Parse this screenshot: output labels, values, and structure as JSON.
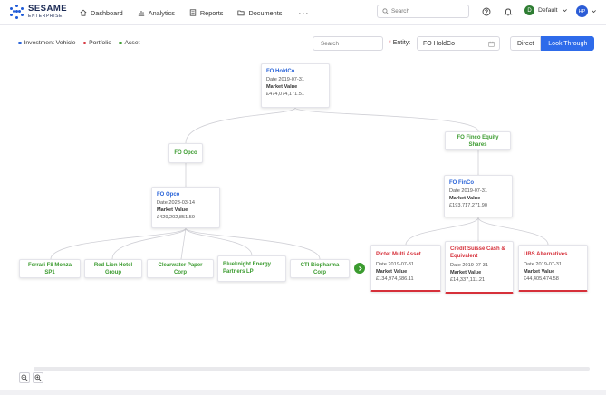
{
  "brand": {
    "name": "SESAME",
    "sub": "ENTERPRISE",
    "color": "#1f5bd8"
  },
  "nav": [
    {
      "label": "Dashboard",
      "icon": "home-icon"
    },
    {
      "label": "Analytics",
      "icon": "bar-chart-icon"
    },
    {
      "label": "Reports",
      "icon": "report-icon"
    },
    {
      "label": "Documents",
      "icon": "folder-icon"
    }
  ],
  "nav_more": "···",
  "search": {
    "placeholder": "Search"
  },
  "profile": {
    "initial": "D",
    "label": "Default"
  },
  "user": {
    "initials": "HP"
  },
  "legend": [
    {
      "label": "Investment Vehicle",
      "color": "#2a64d8"
    },
    {
      "label": "Portfolio",
      "color": "#d6303a"
    },
    {
      "label": "Asset",
      "color": "#3b9b2f"
    }
  ],
  "filter_search": {
    "placeholder": "Search"
  },
  "entity": {
    "label": "Entity:",
    "required": "*",
    "value": "FO HoldCo"
  },
  "view_toggle": {
    "direct": "Direct",
    "look_through": "Look Through",
    "active": "look_through"
  },
  "labels": {
    "date": "Date",
    "market_value": "Market Value"
  },
  "tree": {
    "root": {
      "name": "FO HoldCo",
      "date": "2019-07-31",
      "market_value": "£474,074,171.51"
    },
    "fo_opco_asset": {
      "name": "FO Opco"
    },
    "fo_opco": {
      "name": "FO Opco",
      "date": "2023-03-14",
      "market_value": "£429,202,851.59"
    },
    "fo_finco_shares": {
      "name": "FO Finco Equity Shares"
    },
    "fo_finco": {
      "name": "FO FinCo",
      "date": "2019-07-31",
      "market_value": "£193,717,271.90"
    },
    "assets": [
      {
        "name": "Ferrari F8 Monza SP1"
      },
      {
        "name": "Red Lion Hotel Group"
      },
      {
        "name": "Clearwater Paper Corp"
      },
      {
        "name": "Blueknight Energy Partners LP"
      },
      {
        "name": "CTI Biopharma Corp"
      }
    ],
    "portfolios": [
      {
        "name": "Pictet Multi Asset",
        "date": "2019-07-31",
        "market_value": "£134,974,686.11"
      },
      {
        "name": "Credit Suisse Cash & Equivalent",
        "date": "2019-07-31",
        "market_value": "£14,337,111.21"
      },
      {
        "name": "UBS Alternatives",
        "date": "2019-07-31",
        "market_value": "£44,405,474.58"
      }
    ]
  }
}
